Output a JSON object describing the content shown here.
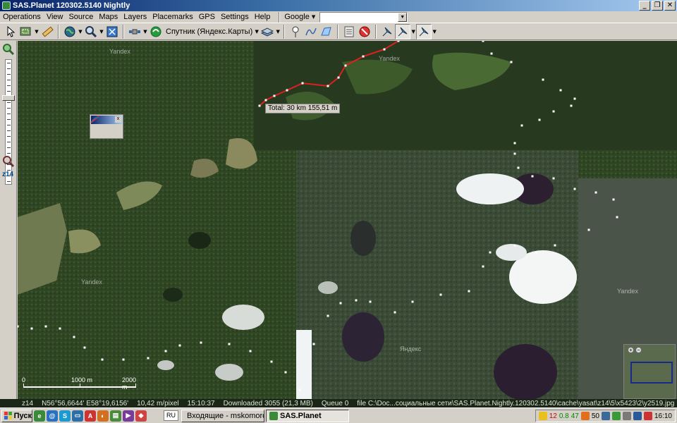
{
  "window": {
    "title": "SAS.Planet 120302.5140 Nightly"
  },
  "window_buttons": {
    "minimize": "_",
    "maximize": "❐",
    "close": "✕"
  },
  "menu": {
    "items": [
      "Operations",
      "View",
      "Source",
      "Maps",
      "Layers",
      "Placemarks",
      "GPS",
      "Settings",
      "Help"
    ],
    "search_provider": "Google",
    "search_value": ""
  },
  "toolbar": {
    "map_type": "Спутник (Яндекс.Карты)"
  },
  "left_toolbar": {
    "zoom_level": "z14",
    "zoom_in_glyph": "+",
    "zoom_out_glyph": "−"
  },
  "map": {
    "watermarks": [
      "Yandex",
      "Yandex",
      "Yandex",
      "Яндекс",
      "Yandex"
    ],
    "total_distance": "Total: 30 km 155,51 m",
    "ruler_close": "x",
    "scale_labels": [
      "0",
      "1000 m",
      "2000 m"
    ],
    "route_color": "#e02020"
  },
  "status": {
    "zoom": "z14",
    "coords": "N56°56,6644' E58°19,6156'",
    "resolution": "10,42 m/pixel",
    "time": "15:10:37",
    "downloaded": "Downloaded 3055 (21,3 MB)",
    "queue": "Queue 0",
    "file": "file C:\\Doc...социальные сети\\SAS.Planet.Nightly.120302.5140\\cache\\yasat\\z14\\5\\x5423\\2\\y2519.jpg"
  },
  "taskbar": {
    "start_label": "Пуск",
    "language": "RU",
    "tasks": [
      {
        "label": "Входящие - mskomoroh..."
      },
      {
        "label": "SAS.Planet"
      }
    ],
    "tray_values": [
      "12",
      "0.8",
      "47",
      "50"
    ],
    "clock": "16:10"
  }
}
